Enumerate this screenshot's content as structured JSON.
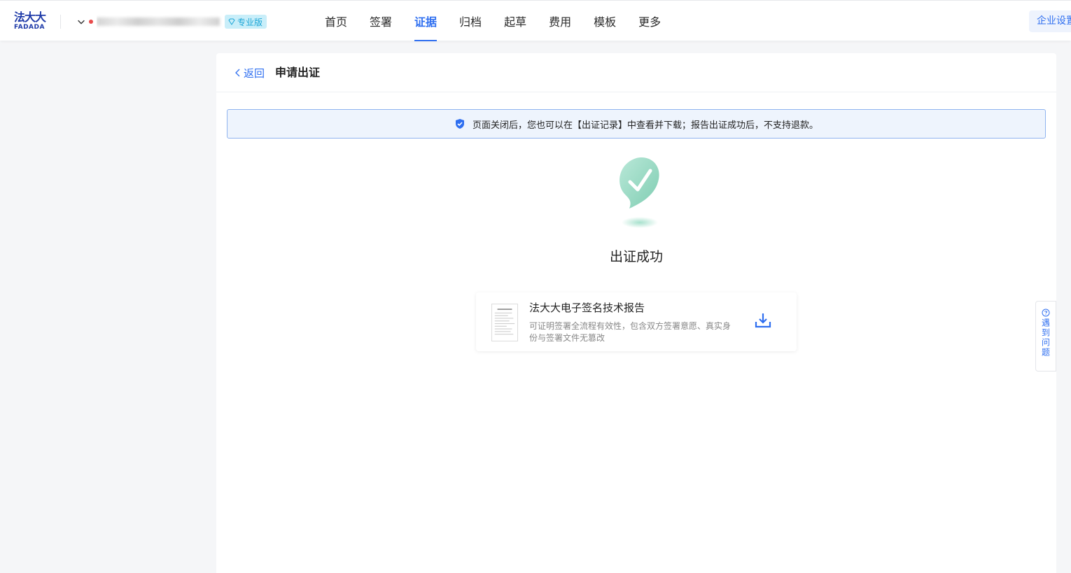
{
  "header": {
    "logo_cn": "法大大",
    "logo_en": "FADADA",
    "company_badge": "专业版",
    "nav": [
      {
        "label": "首页",
        "active": false
      },
      {
        "label": "签署",
        "active": false
      },
      {
        "label": "证据",
        "active": true
      },
      {
        "label": "归档",
        "active": false
      },
      {
        "label": "起草",
        "active": false
      },
      {
        "label": "费用",
        "active": false
      },
      {
        "label": "模板",
        "active": false
      },
      {
        "label": "更多",
        "active": false
      }
    ],
    "settings_label": "企业设置"
  },
  "page": {
    "back_label": "返回",
    "title": "申请出证",
    "notice": "页面关闭后，您也可以在【出证记录】中查看并下载；报告出证成功后，不支持退款。",
    "success_title": "出证成功",
    "report": {
      "name": "法大大电子签名技术报告",
      "description": "可证明签署全流程有效性，包含双方签署意愿、真实身份与签署文件无篡改"
    }
  },
  "help": {
    "label": "遇到问题"
  },
  "colors": {
    "accent": "#2f6ff0",
    "logo": "#1e3aa8",
    "success": "#8fd6bf"
  }
}
